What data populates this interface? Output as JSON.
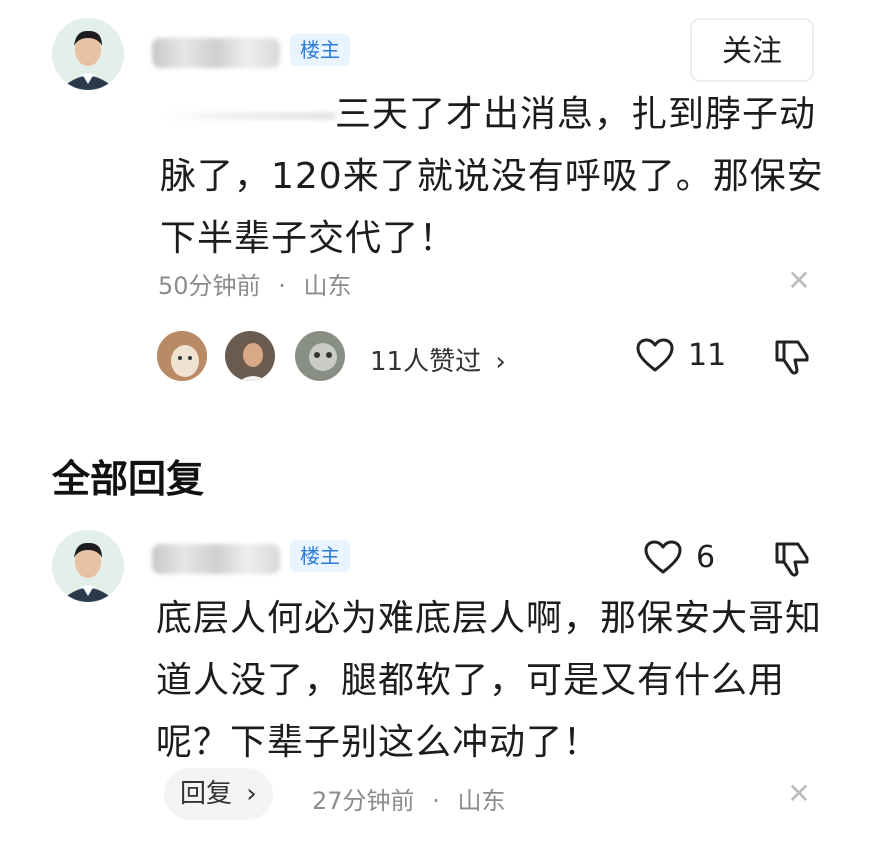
{
  "post": {
    "author_badge": "楼主",
    "follow_label": "关注",
    "content_prefix": "",
    "content": "三天了才出消息，扎到脖子动脉了，120来了就说没有呼吸了。那保安下半辈子交代了！",
    "content_line1": "三天了才出消息，扎到脖子动",
    "content_line2": "脉了，120来了就说没有呼吸了。那保安",
    "content_line3": "下半辈子交代了！",
    "time": "50分钟前",
    "separator": "·",
    "location": "山东",
    "likers_text": "11人赞过",
    "likers_chevron": "›",
    "like_count": "11",
    "icons": {
      "like": "heart-icon",
      "dislike": "thumbs-down-icon",
      "close": "close-icon"
    }
  },
  "section_title": "全部回复",
  "reply": {
    "author_badge": "楼主",
    "like_count": "6",
    "content_line1": "底层人何必为难底层人啊，那保安大哥知",
    "content_line2": "道人没了，腿都软了，可是又有什么用",
    "content_line3": "呢？下辈子别这么冲动了！",
    "reply_button": "回复",
    "reply_chevron": "›",
    "time": "27分钟前",
    "separator": "·",
    "location": "山东"
  }
}
